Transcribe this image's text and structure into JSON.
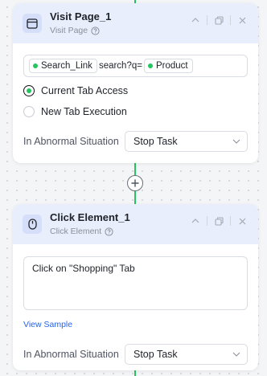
{
  "nodes": [
    {
      "title": "Visit Page_1",
      "subtitle": "Visit Page",
      "icon": "browser-window-icon",
      "url_parts": [
        {
          "type": "chip",
          "text": "Search_Link"
        },
        {
          "type": "text",
          "text": "search?q="
        },
        {
          "type": "chip",
          "text": "Product"
        }
      ],
      "options": [
        {
          "label": "Current Tab Access",
          "checked": true
        },
        {
          "label": "New Tab Execution",
          "checked": false
        }
      ],
      "abnormal_label": "In Abnormal Situation",
      "abnormal_value": "Stop Task"
    },
    {
      "title": "Click Element_1",
      "subtitle": "Click Element",
      "icon": "mouse-icon",
      "description": "Click on \"Shopping\" Tab",
      "view_sample": "View Sample",
      "abnormal_label": "In Abnormal Situation",
      "abnormal_value": "Stop Task"
    }
  ],
  "colors": {
    "accent_green": "#22c55e",
    "header_bg": "#e9eefc",
    "link_blue": "#2563eb"
  }
}
